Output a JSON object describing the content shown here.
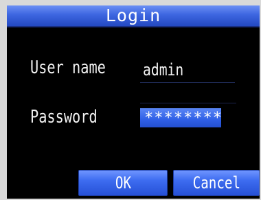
{
  "dialog": {
    "title": "Login",
    "username_label": "User name",
    "username_value": "admin",
    "password_label": "Password",
    "password_value": "********",
    "ok_label": "OK",
    "cancel_label": "Cancel"
  },
  "colors": {
    "background": "#000000",
    "accent": "#3d66e0",
    "text": "#f2f2f2"
  }
}
